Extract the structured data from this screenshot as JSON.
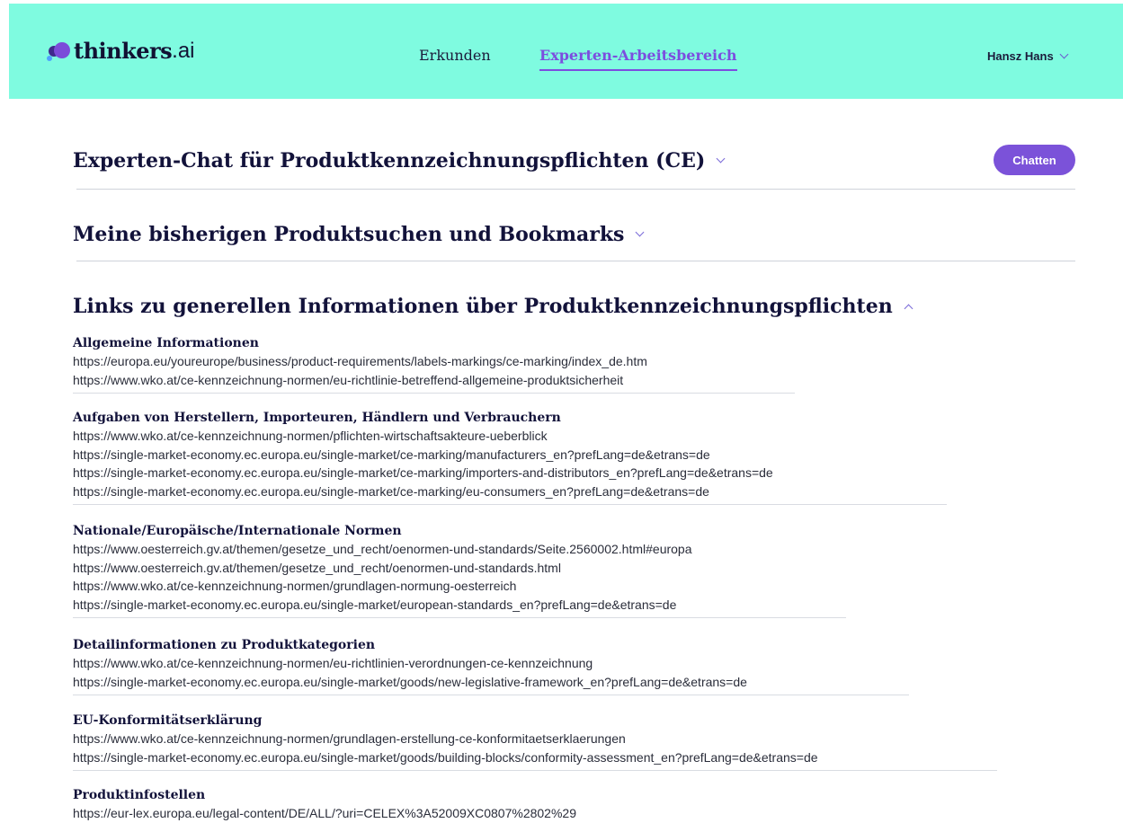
{
  "header": {
    "logo_main": "thinkers",
    "logo_suffix": ".ai",
    "nav": {
      "explore": "Erkunden",
      "workspace": "Experten-Arbeitsbereich"
    },
    "user": "Hansz Hans"
  },
  "sections": {
    "chat": {
      "title": "Experten-Chat für Produktkennzeichnungspflichten (CE)",
      "button": "Chatten"
    },
    "searches": {
      "title": "Meine bisherigen Produktsuchen und Bookmarks"
    },
    "links": {
      "title": "Links zu generellen Informationen über Produktkennzeichnungspflichten"
    }
  },
  "groups": [
    {
      "title": "Allgemeine Informationen",
      "links": [
        "https://europa.eu/youreurope/business/product-requirements/labels-markings/ce-marking/index_de.htm",
        "https://www.wko.at/ce-kennzeichnung-normen/eu-richtlinie-betreffend-allgemeine-produktsicherheit"
      ]
    },
    {
      "title": "Aufgaben von Herstellern, Importeuren, Händlern und Verbrauchern",
      "links": [
        "https://www.wko.at/ce-kennzeichnung-normen/pflichten-wirtschaftsakteure-ueberblick",
        "https://single-market-economy.ec.europa.eu/single-market/ce-marking/manufacturers_en?prefLang=de&etrans=de",
        "https://single-market-economy.ec.europa.eu/single-market/ce-marking/importers-and-distributors_en?prefLang=de&etrans=de",
        "https://single-market-economy.ec.europa.eu/single-market/ce-marking/eu-consumers_en?prefLang=de&etrans=de"
      ]
    },
    {
      "title": "Nationale/Europäische/Internationale Normen",
      "links": [
        "https://www.oesterreich.gv.at/themen/gesetze_und_recht/oenormen-und-standards/Seite.2560002.html#europa",
        "https://www.oesterreich.gv.at/themen/gesetze_und_recht/oenormen-und-standards.html",
        "https://www.wko.at/ce-kennzeichnung-normen/grundlagen-normung-oesterreich",
        "https://single-market-economy.ec.europa.eu/single-market/european-standards_en?prefLang=de&etrans=de"
      ]
    },
    {
      "title": "Detailinformationen zu Produktkategorien",
      "links": [
        "https://www.wko.at/ce-kennzeichnung-normen/eu-richtlinien-verordnungen-ce-kennzeichnung",
        "https://single-market-economy.ec.europa.eu/single-market/goods/new-legislative-framework_en?prefLang=de&etrans=de"
      ]
    },
    {
      "title": "EU-Konformitätserklärung",
      "links": [
        "https://www.wko.at/ce-kennzeichnung-normen/grundlagen-erstellung-ce-konformitaetserklaerungen",
        "https://single-market-economy.ec.europa.eu/single-market/goods/building-blocks/conformity-assessment_en?prefLang=de&etrans=de"
      ]
    },
    {
      "title": "Produktinfostellen",
      "links": [
        "https://eur-lex.europa.eu/legal-content/DE/ALL/?uri=CELEX%3A52009XC0807%2802%29"
      ]
    }
  ]
}
